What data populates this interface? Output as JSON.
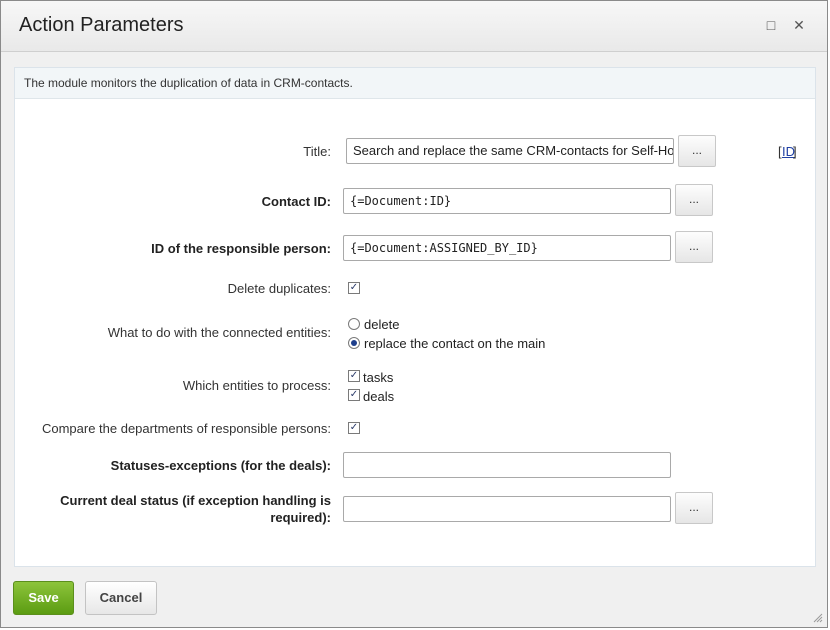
{
  "dialog": {
    "title": "Action Parameters",
    "maximize_icon": "□",
    "close_icon": "✕"
  },
  "description": "The module monitors the duplication of data in CRM-contacts.",
  "fields": {
    "title": {
      "label": "Title:",
      "value": "Search and replace the same CRM-contacts for Self-Ho",
      "dots": "...",
      "id_link": "ID"
    },
    "contact_id": {
      "label": "Contact ID:",
      "value": "{=Document:ID}",
      "dots": "..."
    },
    "responsible_id": {
      "label": "ID of the responsible person:",
      "value": "{=Document:ASSIGNED_BY_ID}",
      "dots": "..."
    },
    "delete_duplicates": {
      "label": "Delete duplicates:",
      "checked": true
    },
    "connected_entities": {
      "label": "What to do with the connected entities:",
      "options": [
        {
          "label": "delete",
          "selected": false
        },
        {
          "label": "replace the contact on the main",
          "selected": true
        }
      ]
    },
    "entities_to_process": {
      "label": "Which entities to process:",
      "options": [
        {
          "label": "tasks",
          "checked": true
        },
        {
          "label": "deals",
          "checked": true
        }
      ]
    },
    "compare_departments": {
      "label": "Compare the departments of responsible persons:",
      "checked": true
    },
    "statuses_exceptions": {
      "label": "Statuses-exceptions (for the deals):",
      "value": ""
    },
    "current_deal_status": {
      "label_line1": "Current deal status (if exception handling is",
      "label_line2": "required):",
      "value": "",
      "dots": "..."
    }
  },
  "buttons": {
    "save": "Save",
    "cancel": "Cancel"
  },
  "check_mark": "✓"
}
